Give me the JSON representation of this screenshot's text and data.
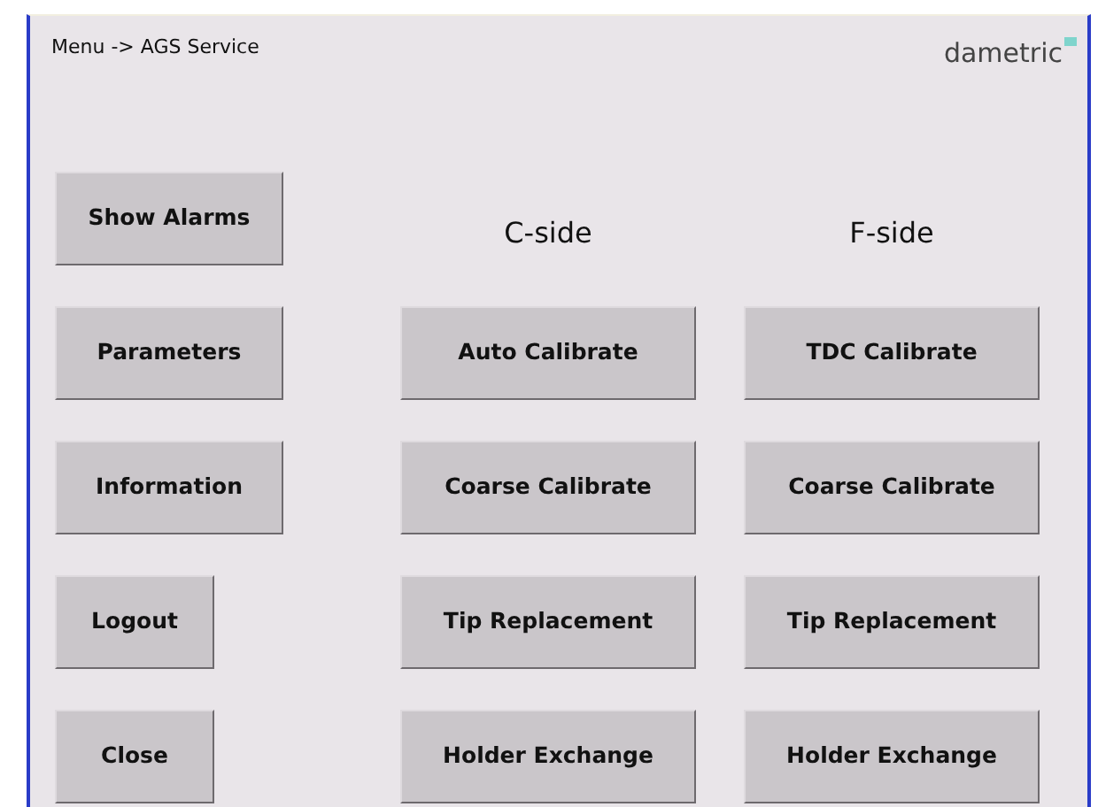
{
  "header": {
    "breadcrumb": "Menu -> AGS Service",
    "logo": "dametric"
  },
  "menu_buttons": [
    "Show Alarms",
    "Parameters",
    "Information",
    "Logout",
    "Close"
  ],
  "sides": [
    {
      "title": "C-side",
      "buttons": [
        "Auto Calibrate",
        "Coarse Calibrate",
        "Tip Replacement",
        "Holder Exchange"
      ]
    },
    {
      "title": "F-side",
      "buttons": [
        "TDC Calibrate",
        "Coarse Calibrate",
        "Tip Replacement",
        "Holder Exchange"
      ]
    }
  ]
}
